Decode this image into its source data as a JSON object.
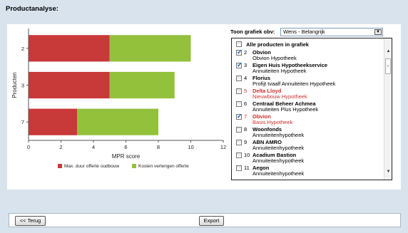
{
  "page": {
    "title": "Productanalyse:"
  },
  "controls": {
    "toon_label": "Toon grafiek obv:",
    "select_value": "Wens - Belangrijk",
    "all_products_label": "Alle producten in grafiek"
  },
  "products": [
    {
      "num": "2",
      "name": "Obvion",
      "sub": "Obvion Hypotheek",
      "checked": true,
      "red": false
    },
    {
      "num": "3",
      "name": "Eigen Huis Hypotheekservice",
      "sub": "Annuiteiten Hypotheek",
      "checked": true,
      "red": false
    },
    {
      "num": "4",
      "name": "Florius",
      "sub": "Profijt tvaalf Annuiteiten Hypotheek",
      "checked": false,
      "red": false
    },
    {
      "num": "5",
      "name": "Delta Lloyd",
      "sub": "Nieuwbouw Hypotheek",
      "checked": false,
      "red": true
    },
    {
      "num": "6",
      "name": "Centraal Beheer Achmea",
      "sub": "Annuiteiten Plus Hypotheek",
      "checked": false,
      "red": false
    },
    {
      "num": "7",
      "name": "Obvion",
      "sub": "Basis Hypotheek",
      "checked": true,
      "red": true
    },
    {
      "num": "8",
      "name": "Woonfonds",
      "sub": "Annuiteitenhypotheek",
      "checked": false,
      "red": false
    },
    {
      "num": "9",
      "name": "ABN AMRO",
      "sub": "Annuiteitenhypotheek",
      "checked": false,
      "red": false
    },
    {
      "num": "10",
      "name": "Acadium Bastion",
      "sub": "Annuiteitenhypotheek",
      "checked": false,
      "red": false
    },
    {
      "num": "11",
      "name": "Aegon",
      "sub": "Annuiteitenhypotheek",
      "checked": false,
      "red": false
    }
  ],
  "footer": {
    "back_label": "<< Terug",
    "export_label": "Export"
  },
  "colors": {
    "series1": "#c8393a",
    "series2": "#93c13c"
  },
  "chart_data": {
    "type": "bar",
    "orientation": "horizontal",
    "stacked": true,
    "categories": [
      "2",
      "3",
      "7"
    ],
    "series": [
      {
        "name": "Max. duur offerte oudbouw",
        "values": [
          5,
          5,
          3
        ]
      },
      {
        "name": "Kosten verlengen offerte",
        "values": [
          5,
          4,
          5
        ]
      }
    ],
    "xlabel": "MPR score",
    "ylabel": "Producten",
    "xlim": [
      0,
      12
    ],
    "xticks": [
      "0",
      "2",
      "4",
      "6",
      "8",
      "10",
      "12"
    ],
    "legend_position": "bottom",
    "grid": false
  }
}
